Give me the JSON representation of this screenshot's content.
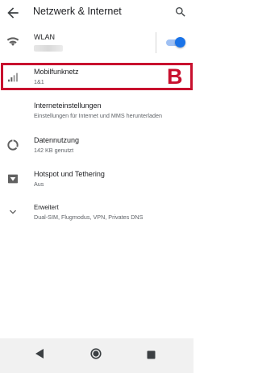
{
  "header": {
    "title": "Netzwerk & Internet",
    "back_icon": "arrow-back-icon",
    "search_icon": "search-icon"
  },
  "items": {
    "wlan": {
      "title": "WLAN",
      "icon": "wifi-icon",
      "toggle_on": true
    },
    "mobile": {
      "title": "Mobilfunknetz",
      "subtitle": "1&1",
      "icon": "signal-icon"
    },
    "internet_settings": {
      "title": "Interneteinstellungen",
      "subtitle": "Einstellungen für Internet und MMS herunterladen"
    },
    "data_usage": {
      "title": "Datennutzung",
      "subtitle": "142 KB genutzt",
      "icon": "data-usage-icon"
    },
    "hotspot": {
      "title": "Hotspot und Tethering",
      "subtitle": "Aus",
      "icon": "hotspot-icon"
    },
    "advanced": {
      "title": "Erweitert",
      "subtitle": "Dual-SIM, Flugmodus, VPN, Privates DNS",
      "icon": "chevron-down-icon"
    }
  },
  "annotation": {
    "marker": "B"
  },
  "nav": {
    "back_icon": "nav-back-icon",
    "home_icon": "nav-home-icon",
    "recents_icon": "nav-recents-icon"
  },
  "colors": {
    "accent": "#1a73e8",
    "highlight": "#c8102e",
    "icon_gray": "#616161"
  }
}
